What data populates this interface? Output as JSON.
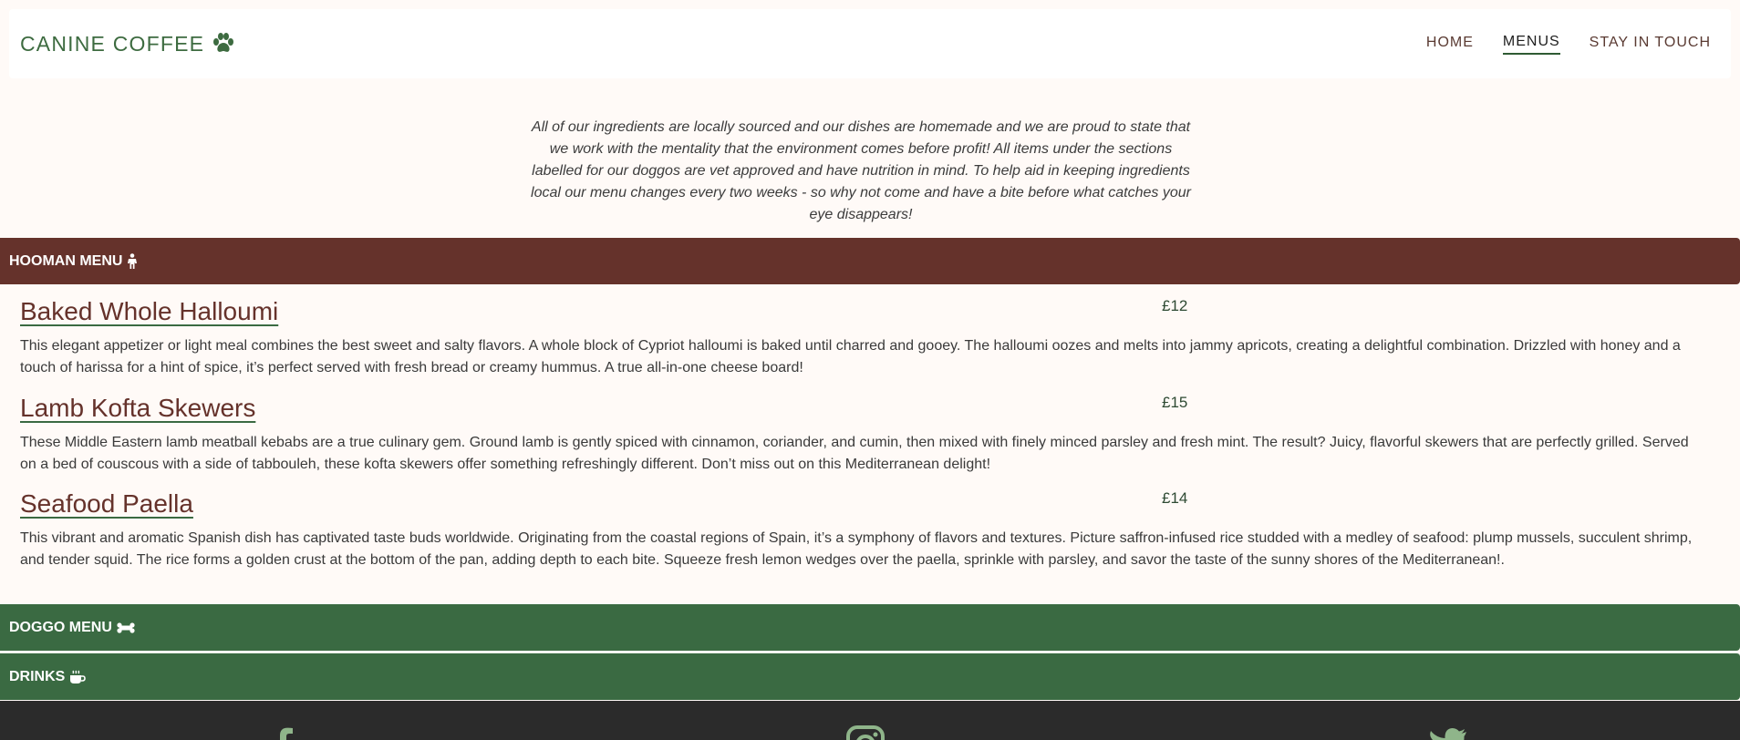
{
  "header": {
    "brand": "CANINE COFFEE",
    "brand_icon": "paw-icon",
    "nav": [
      {
        "label": "HOME",
        "active": false
      },
      {
        "label": "MENUS",
        "active": true
      },
      {
        "label": "STAY IN TOUCH",
        "active": false
      }
    ]
  },
  "intro": "All of our ingredients are locally sourced and our dishes are homemade and we are proud to state that we work with the mentality that the environment comes before profit! All items under the sections labelled for our doggos are vet approved and have nutrition in mind. To help aid in keeping ingredients local our menu changes every two weeks - so why not come and have a bite before what catches your eye disappears!",
  "sections": {
    "hooman": {
      "label": "HOOMAN MENU",
      "icon": "person-icon",
      "color": "#65322b"
    },
    "doggo": {
      "label": "DOGGO MENU",
      "icon": "bone-icon",
      "color": "#3a6a42"
    },
    "drinks": {
      "label": "DRINKS",
      "icon": "coffee-cup-icon",
      "color": "#3a6a42"
    }
  },
  "hooman_items": [
    {
      "title": "Baked Whole Halloumi",
      "price": "£12",
      "desc": "This elegant appetizer or light meal combines the best sweet and salty flavors. A whole block of Cypriot halloumi is baked until charred and gooey. The halloumi oozes and melts into jammy apricots, creating a delightful combination. Drizzled with honey and a touch of harissa for a hint of spice, it’s perfect served with fresh bread or creamy hummus. A true all-in-one cheese board!"
    },
    {
      "title": "Lamb Kofta Skewers",
      "price": "£15",
      "desc": "These Middle Eastern lamb meatball kebabs are a true culinary gem. Ground lamb is gently spiced with cinnamon, coriander, and cumin, then mixed with finely minced parsley and fresh mint. The result? Juicy, flavorful skewers that are perfectly grilled. Served on a bed of couscous with a side of tabbouleh, these kofta skewers offer something refreshingly different. Don’t miss out on this Mediterranean delight!"
    },
    {
      "title": "Seafood Paella",
      "price": "£14",
      "desc": "This vibrant and aromatic Spanish dish has captivated taste buds worldwide. Originating from the coastal regions of Spain, it’s a symphony of flavors and textures. Picture saffron-infused rice studded with a medley of seafood: plump mussels, succulent shrimp, and tender squid. The rice forms a golden crust at the bottom of the pan, adding depth to each bite. Squeeze fresh lemon wedges over the paella, sprinkle with parsley, and savor the taste of the sunny shores of the Mediterranean!."
    }
  ],
  "footer": {
    "icons": [
      "facebook-icon",
      "instagram-icon",
      "twitter-icon"
    ],
    "icon_color": "#8fb58a"
  }
}
